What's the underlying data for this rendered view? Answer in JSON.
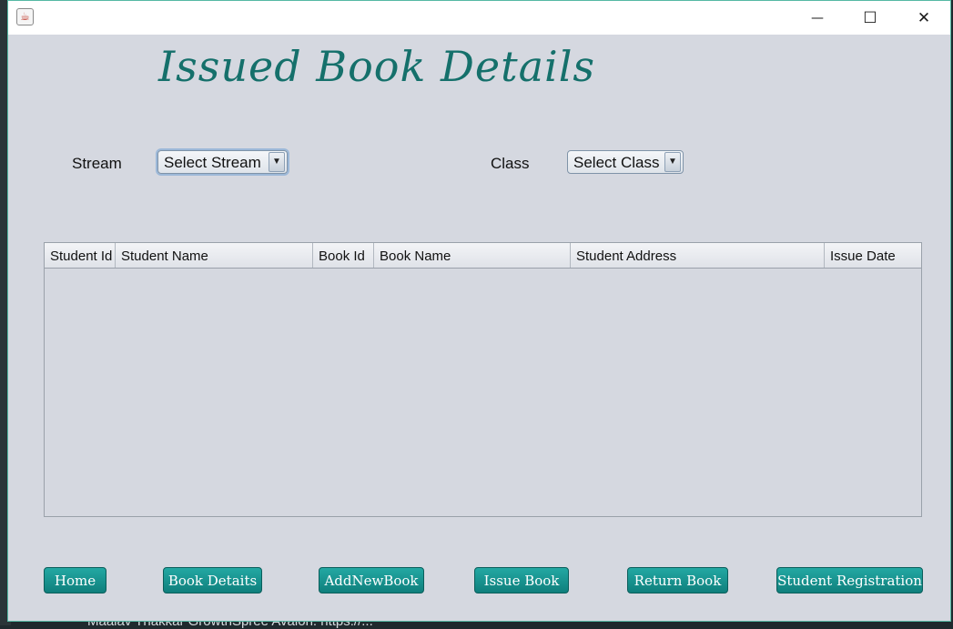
{
  "window": {
    "app_icon": "java-cup-icon",
    "controls": {
      "minimize": "—",
      "maximize": "☐",
      "close": "✕"
    }
  },
  "heading": "Issued Book Details",
  "filters": {
    "stream_label": "Stream",
    "stream_value": "Select Stream",
    "class_label": "Class",
    "class_value": "Select Class"
  },
  "table": {
    "columns": [
      "Student Id",
      "Student Name",
      "Book Id",
      "Book Name",
      "Student Address",
      "Issue Date"
    ],
    "rows": []
  },
  "nav_buttons": {
    "home": "Home",
    "book_details": "Book Detaits",
    "add_new_book": "AddNewBook",
    "issue_book": "Issue Book",
    "return_book": "Return Book",
    "student_registration": "Student Registration"
  },
  "colors": {
    "accent": "#15706b",
    "button": "#1a9590",
    "panel": "#d5d8e0"
  }
}
